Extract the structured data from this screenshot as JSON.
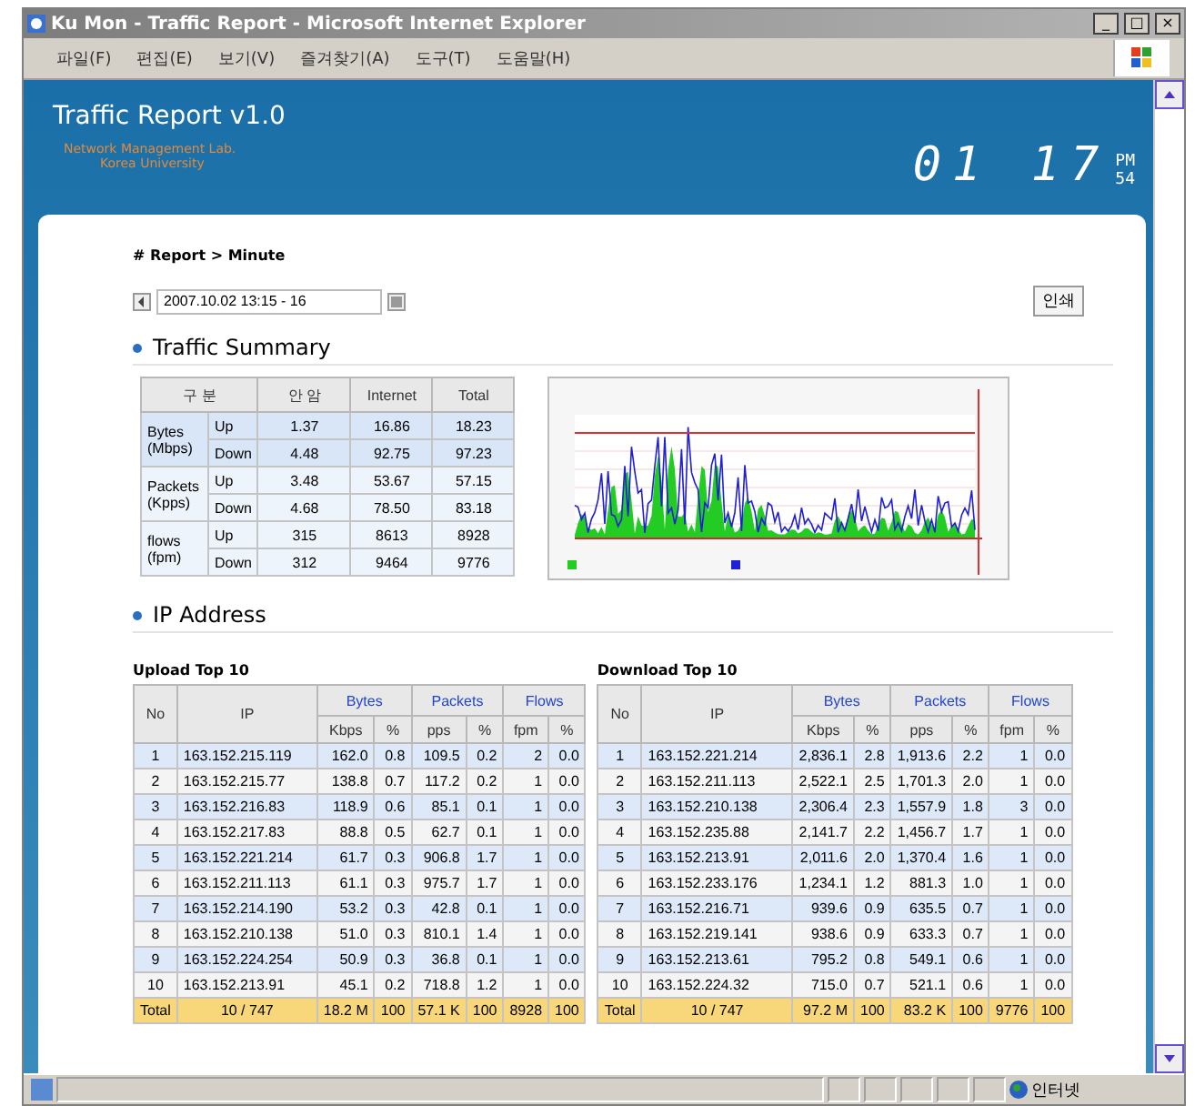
{
  "window": {
    "title": "Ku Mon - Traffic Report - Microsoft Internet Explorer",
    "controls": [
      "_",
      "□",
      "×"
    ]
  },
  "menu": [
    "파일(F)",
    "편집(E)",
    "보기(V)",
    "즐겨찾기(A)",
    "도구(T)",
    "도움말(H)"
  ],
  "header": {
    "title": "Traffic Report v1.0",
    "subtitle": [
      "Network Management Lab.",
      "Korea University"
    ],
    "clock": {
      "hours": "01",
      "minutes": "17",
      "ampm": "PM",
      "seconds": "54"
    }
  },
  "breadcrumb": "# Report > Minute",
  "period": {
    "value": "2007.10.02 13:15 - 16"
  },
  "print_button": "인쇄",
  "summary": {
    "title": "Traffic Summary",
    "columns": [
      "구 분",
      "안 암",
      "Internet",
      "Total"
    ],
    "groups": [
      {
        "label": "Bytes (Mbps)",
        "rows": [
          {
            "dir": "Up",
            "values": [
              "1.37",
              "16.86",
              "18.23"
            ]
          },
          {
            "dir": "Down",
            "values": [
              "4.48",
              "92.75",
              "97.23"
            ]
          }
        ]
      },
      {
        "label": "Packets (Kpps)",
        "rows": [
          {
            "dir": "Up",
            "values": [
              "3.48",
              "53.67",
              "57.15"
            ]
          },
          {
            "dir": "Down",
            "values": [
              "4.68",
              "78.50",
              "83.18"
            ]
          }
        ]
      },
      {
        "label": "flows (fpm)",
        "rows": [
          {
            "dir": "Up",
            "values": [
              "315",
              "8613",
              "8928"
            ]
          },
          {
            "dir": "Down",
            "values": [
              "312",
              "9464",
              "9776"
            ]
          }
        ]
      }
    ]
  },
  "ip_section": {
    "title": "IP Address"
  },
  "tables": [
    {
      "title": "Upload Top 10",
      "header": [
        "No",
        "IP",
        "Bytes",
        "Packets",
        "Flows"
      ],
      "subheader": [
        "Kbps",
        "%",
        "pps",
        "%",
        "fpm",
        "%"
      ],
      "rows": [
        [
          "1",
          "163.152.215.119",
          "162.0",
          "0.8",
          "109.5",
          "0.2",
          "2",
          "0.0"
        ],
        [
          "2",
          "163.152.215.77",
          "138.8",
          "0.7",
          "117.2",
          "0.2",
          "1",
          "0.0"
        ],
        [
          "3",
          "163.152.216.83",
          "118.9",
          "0.6",
          "85.1",
          "0.1",
          "1",
          "0.0"
        ],
        [
          "4",
          "163.152.217.83",
          "88.8",
          "0.5",
          "62.7",
          "0.1",
          "1",
          "0.0"
        ],
        [
          "5",
          "163.152.221.214",
          "61.7",
          "0.3",
          "906.8",
          "1.7",
          "1",
          "0.0"
        ],
        [
          "6",
          "163.152.211.113",
          "61.1",
          "0.3",
          "975.7",
          "1.7",
          "1",
          "0.0"
        ],
        [
          "7",
          "163.152.214.190",
          "53.2",
          "0.3",
          "42.8",
          "0.1",
          "1",
          "0.0"
        ],
        [
          "8",
          "163.152.210.138",
          "51.0",
          "0.3",
          "810.1",
          "1.4",
          "1",
          "0.0"
        ],
        [
          "9",
          "163.152.224.254",
          "50.9",
          "0.3",
          "36.8",
          "0.1",
          "1",
          "0.0"
        ],
        [
          "10",
          "163.152.213.91",
          "45.1",
          "0.2",
          "718.8",
          "1.2",
          "1",
          "0.0"
        ]
      ],
      "total": [
        "Total",
        "10 / 747",
        "18.2 M",
        "100",
        "57.1 K",
        "100",
        "8928",
        "100"
      ]
    },
    {
      "title": "Download Top 10",
      "header": [
        "No",
        "IP",
        "Bytes",
        "Packets",
        "Flows"
      ],
      "subheader": [
        "Kbps",
        "%",
        "pps",
        "%",
        "fpm",
        "%"
      ],
      "rows": [
        [
          "1",
          "163.152.221.214",
          "2,836.1",
          "2.8",
          "1,913.6",
          "2.2",
          "1",
          "0.0"
        ],
        [
          "2",
          "163.152.211.113",
          "2,522.1",
          "2.5",
          "1,701.3",
          "2.0",
          "1",
          "0.0"
        ],
        [
          "3",
          "163.152.210.138",
          "2,306.4",
          "2.3",
          "1,557.9",
          "1.8",
          "3",
          "0.0"
        ],
        [
          "4",
          "163.152.235.88",
          "2,141.7",
          "2.2",
          "1,456.7",
          "1.7",
          "1",
          "0.0"
        ],
        [
          "5",
          "163.152.213.91",
          "2,011.6",
          "2.0",
          "1,370.4",
          "1.6",
          "1",
          "0.0"
        ],
        [
          "6",
          "163.152.233.176",
          "1,234.1",
          "1.2",
          "881.3",
          "1.0",
          "1",
          "0.0"
        ],
        [
          "7",
          "163.152.216.71",
          "939.6",
          "0.9",
          "635.5",
          "0.7",
          "1",
          "0.0"
        ],
        [
          "8",
          "163.152.219.141",
          "938.6",
          "0.9",
          "633.3",
          "0.7",
          "1",
          "0.0"
        ],
        [
          "9",
          "163.152.213.61",
          "795.2",
          "0.8",
          "549.1",
          "0.6",
          "1",
          "0.0"
        ],
        [
          "10",
          "163.152.224.32",
          "715.0",
          "0.7",
          "521.1",
          "0.6",
          "1",
          "0.0"
        ]
      ],
      "total": [
        "Total",
        "10 / 747",
        "97.2 M",
        "100",
        "83.2 K",
        "100",
        "9776",
        "100"
      ]
    }
  ],
  "status_bar": {
    "zone": "인터넷"
  }
}
